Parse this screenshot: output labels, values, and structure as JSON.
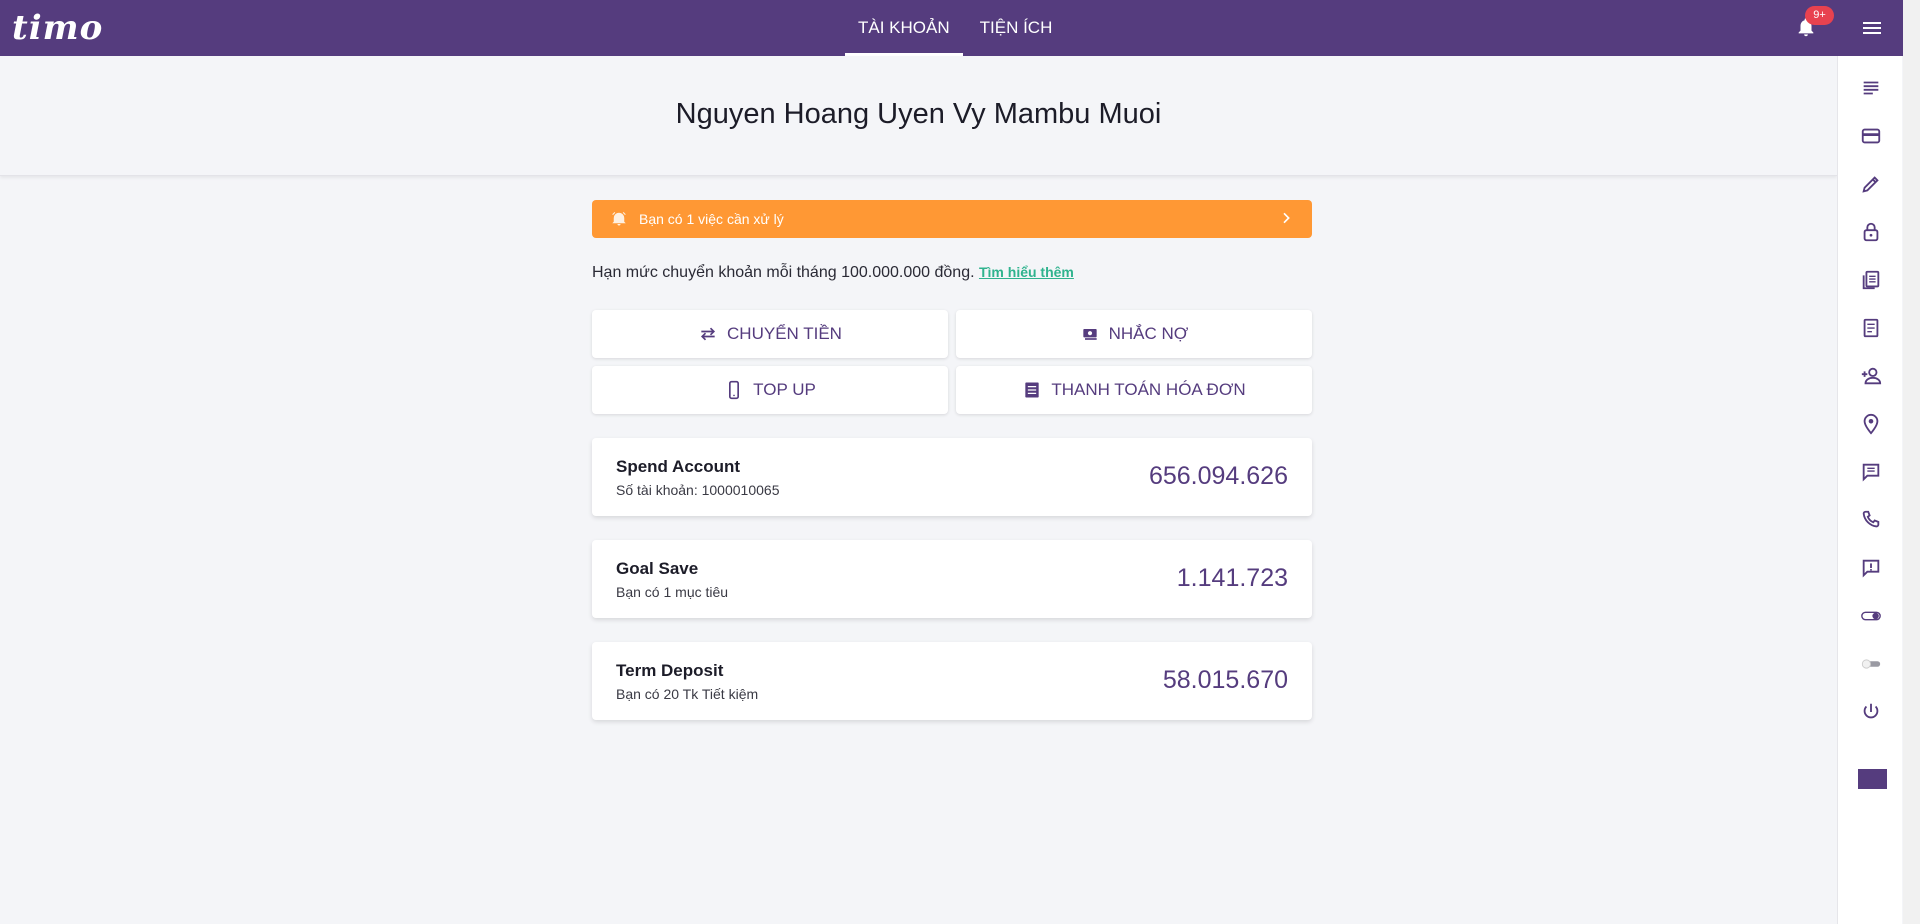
{
  "topbar": {
    "logo": "timo",
    "tabs": [
      {
        "label": "TÀI KHOẢN",
        "active": true
      },
      {
        "label": "TIỆN ÍCH",
        "active": false
      }
    ],
    "notification_badge": "9+"
  },
  "header": {
    "user_name": "Nguyen Hoang Uyen Vy Mambu Muoi"
  },
  "alert": {
    "text": "Bạn có 1 việc cần xử lý",
    "color": "#ff9834"
  },
  "limit": {
    "text": "Hạn mức chuyển khoản mỗi tháng 100.000.000 đồng.",
    "link": "Tìm hiểu thêm"
  },
  "actions": {
    "transfer": "CHUYỂN TIỀN",
    "debt_reminder": "NHẮC NỢ",
    "top_up": "TOP UP",
    "bill_payment": "THANH TOÁN HÓA ĐƠN"
  },
  "accounts": [
    {
      "name": "Spend Account",
      "sub": "Số tài khoản: 1000010065",
      "amount": "656.094.626"
    },
    {
      "name": "Goal Save",
      "sub": "Bạn có 1 mục tiêu",
      "amount": "1.141.723"
    },
    {
      "name": "Term Deposit",
      "sub": "Bạn có 20 Tk Tiết kiệm",
      "amount": "58.015.670"
    }
  ],
  "rail_icons": [
    "notes-icon",
    "card-icon",
    "pencil-icon",
    "lock-icon",
    "documents-icon",
    "receipt-icon",
    "add-person-icon",
    "location-pin-icon",
    "chat-icon",
    "phone-icon",
    "feedback-icon",
    "toggle-on-icon",
    "toggle-off-icon",
    "power-icon"
  ],
  "colors": {
    "brand": "#553c7e",
    "accent_link": "#2fb38e",
    "badge": "#e8424f"
  }
}
